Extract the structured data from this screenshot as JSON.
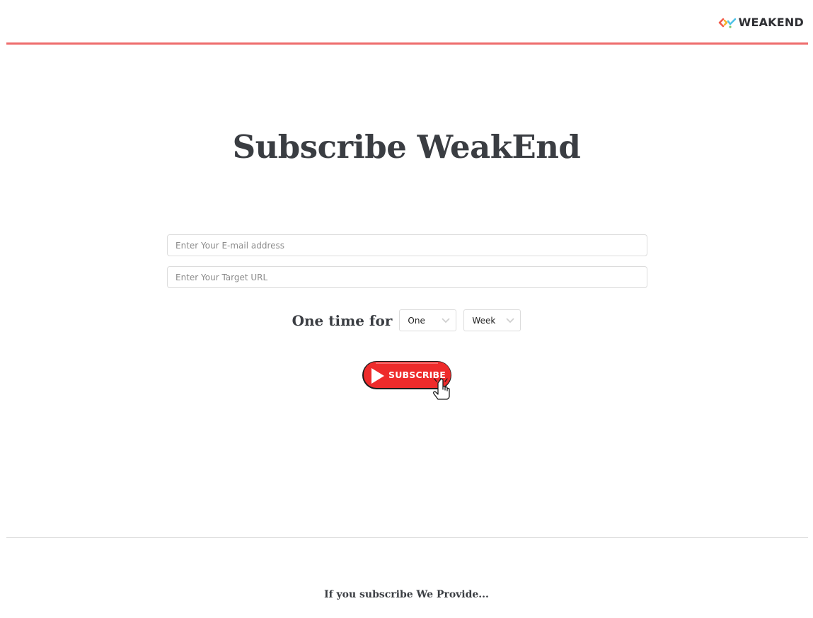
{
  "header": {
    "logo_text": "WEAKEND",
    "accent_color": "#ee6c6c",
    "logo_icon": "colorful-arrows-logo-icon"
  },
  "main": {
    "title": "Subscribe WeakEnd",
    "email_placeholder": "Enter Your E-mail address",
    "url_placeholder": "Enter Your Target URL",
    "frequency": {
      "label": "One time for",
      "count_value": "One",
      "unit_value": "Week",
      "dropdown_icon": "chevron-down-icon"
    },
    "subscribe_button": {
      "label": "SUBSCRIBE",
      "color": "#ee2b2b",
      "icons": [
        "play-icon",
        "hand-cursor-icon"
      ]
    }
  },
  "footer": {
    "provide_text": "If you subscribe We Provide..."
  }
}
